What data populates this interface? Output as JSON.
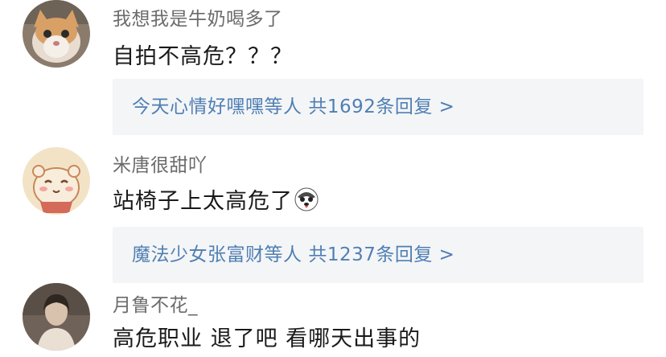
{
  "comments": [
    {
      "username": "我想我是牛奶喝多了",
      "text": "自拍不高危？？？",
      "avatar_icon": "cat-photo-avatar",
      "replies": {
        "users": "今天心情好嘿嘿等人",
        "count_text": "共1692条回复",
        "arrow": ">"
      }
    },
    {
      "username": "米唐很甜吖",
      "text": "站椅子上太高危了",
      "emoji_icon": "husky-emoji",
      "avatar_icon": "cartoon-hamster-avatar",
      "replies": {
        "users": "魔法少女张富财等人",
        "count_text": "共1237条回复",
        "arrow": ">"
      }
    },
    {
      "username": "月鲁不花_",
      "text": "高危职业 退了吧 看哪天出事的",
      "avatar_icon": "person-photo-avatar"
    }
  ],
  "colors": {
    "username": "#6b6b6b",
    "text": "#1a1a1a",
    "link": "#4f7fb3",
    "reply_bg": "#f4f5f7"
  }
}
